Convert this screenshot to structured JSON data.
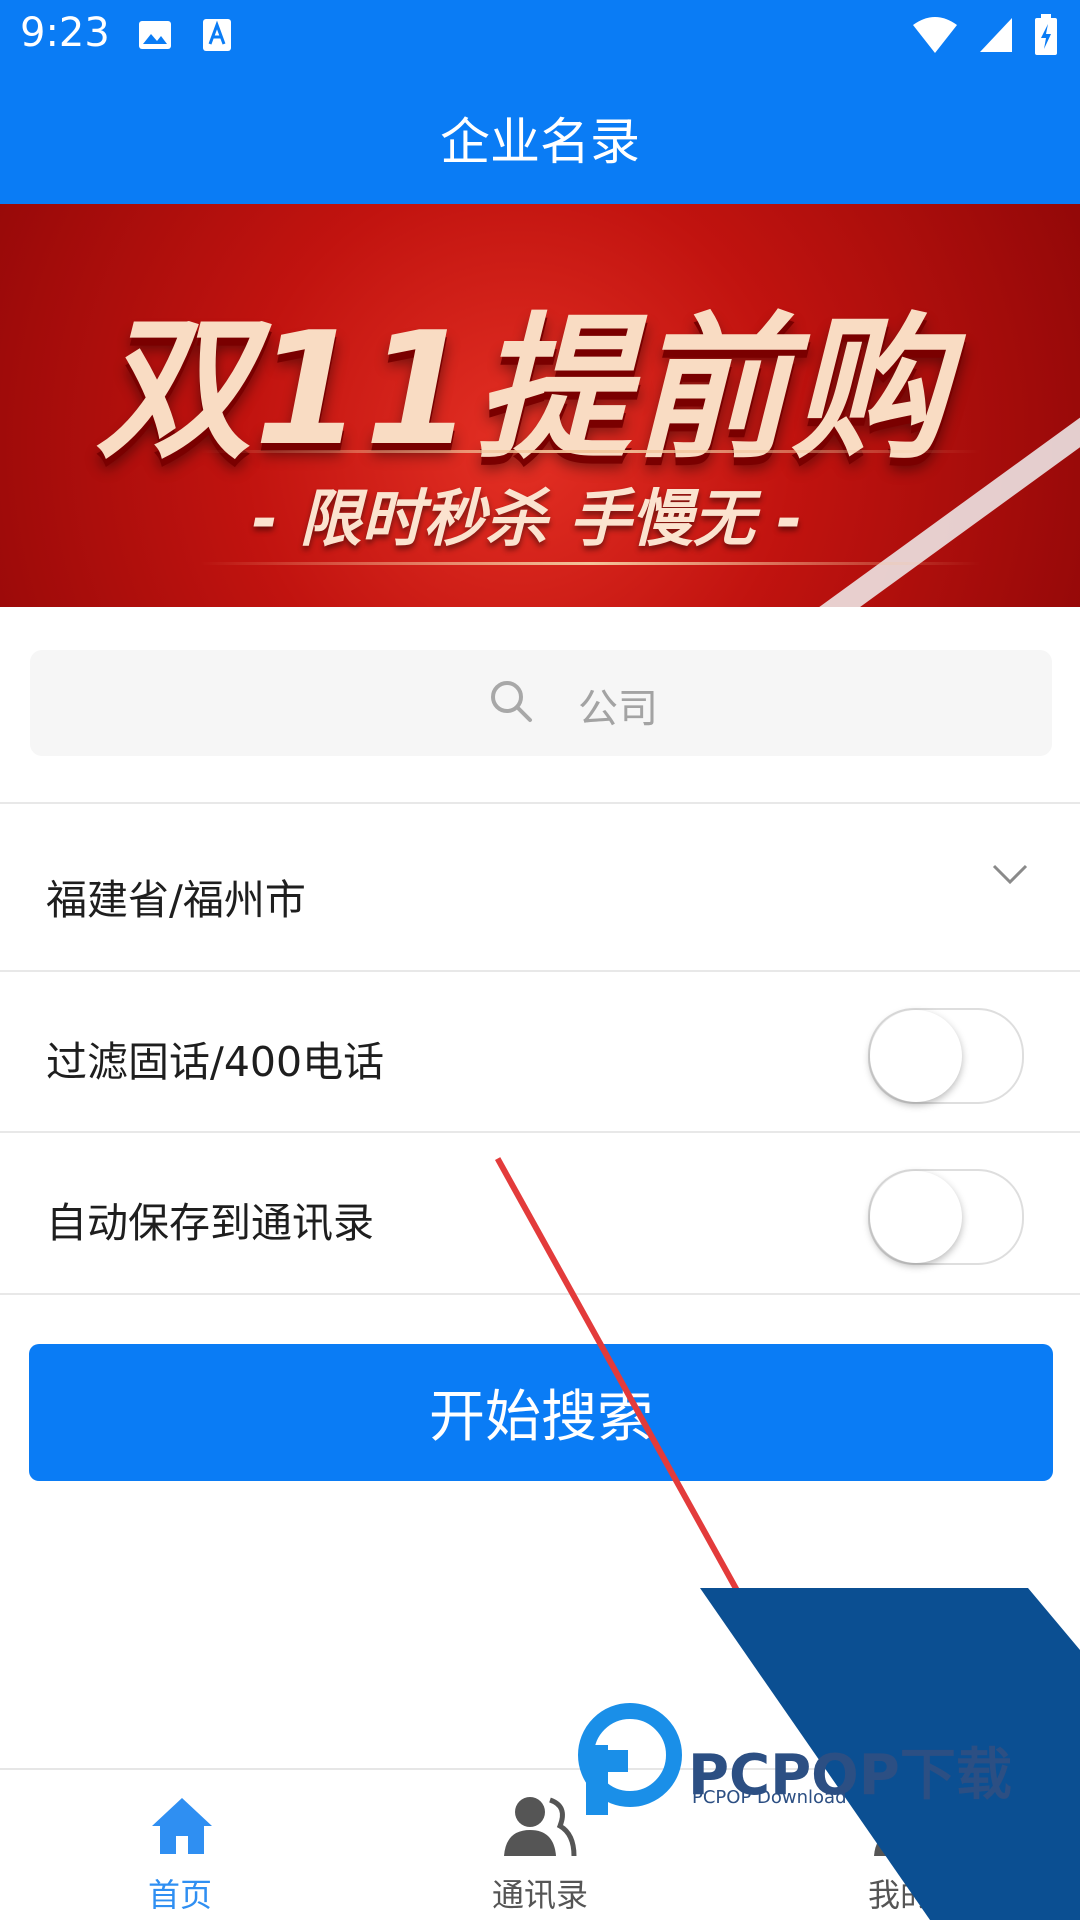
{
  "status_bar": {
    "time": "9:23",
    "left_icons": [
      "image-icon",
      "text-a-icon"
    ],
    "right_icons": [
      "wifi-icon",
      "signal-icon",
      "battery-charging-icon"
    ]
  },
  "header": {
    "title": "企业名录"
  },
  "banner": {
    "main_text": "双11提前购",
    "sub_text": "- 限时秒杀 手慢无 -"
  },
  "search": {
    "placeholder": "公司",
    "value": ""
  },
  "location": {
    "value": "福建省/福州市"
  },
  "filters": [
    {
      "label": "过滤固话/400电话",
      "on": false
    },
    {
      "label": "自动保存到通讯录",
      "on": false
    }
  ],
  "start_button": {
    "label": "开始搜索"
  },
  "bottom_nav": {
    "items": [
      {
        "label": "首页",
        "icon": "home-icon",
        "active": true
      },
      {
        "label": "通讯录",
        "icon": "contacts-icon",
        "active": false
      },
      {
        "label": "我的",
        "icon": "person-icon",
        "active": false
      }
    ]
  },
  "watermark": {
    "brand": "PCPOP下载",
    "sub": "PCPOP Download"
  },
  "colors": {
    "primary": "#0a7cf5",
    "banner_red": "#c1130f",
    "nav_active": "#2f8ff2",
    "nav_inactive": "#555555",
    "watermark_blue": "#0b4f92"
  }
}
